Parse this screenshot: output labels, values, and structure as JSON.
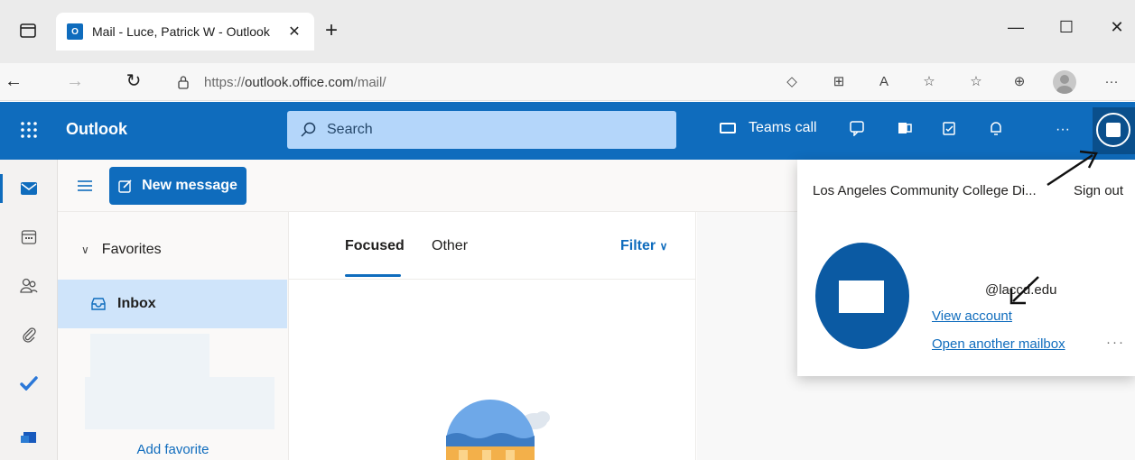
{
  "browser": {
    "tab_title": "Mail - Luce, Patrick W - Outlook",
    "tab_close": "✕",
    "new_tab": "+",
    "url_scheme": "https://",
    "url_host": "outlook.office.com",
    "url_path": "/mail/",
    "window_controls": {
      "minimize": "—",
      "maximize": "☐",
      "close": "✕"
    },
    "more_label": "···"
  },
  "header": {
    "brand": "Outlook",
    "search_placeholder": "Search",
    "teams_call": "Teams call",
    "more_label": "···",
    "accent": "#0f6cbd"
  },
  "commands": {
    "new_message": "New message"
  },
  "folders": {
    "favorites": "Favorites",
    "inbox": "Inbox",
    "add_favorite": "Add favorite"
  },
  "message_list": {
    "tabs": [
      "Focused",
      "Other"
    ],
    "filter": "Filter"
  },
  "account": {
    "organization": "Los Angeles Community College Di...",
    "sign_out": "Sign out",
    "email": "@laccd.edu",
    "view_account": "View account",
    "open_mailbox": "Open another mailbox",
    "more": "···"
  }
}
